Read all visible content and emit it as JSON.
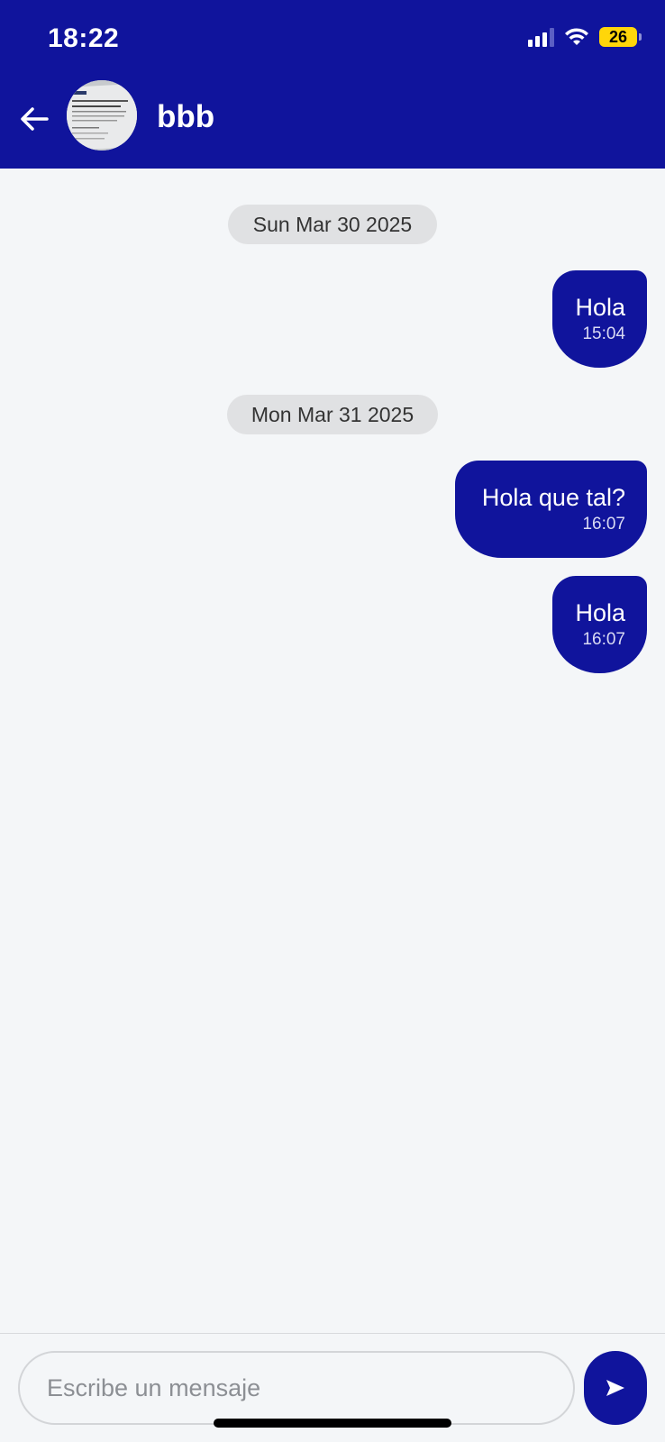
{
  "status_bar": {
    "time": "18:22",
    "battery": "26"
  },
  "header": {
    "contact_name": "bbb",
    "back_icon": "arrow-left-icon"
  },
  "colors": {
    "primary": "#10149c",
    "background": "#f4f6f8",
    "date_pill": "#e0e1e3"
  },
  "messages": [
    {
      "type": "date",
      "label": "Sun Mar 30 2025"
    },
    {
      "type": "outgoing",
      "text": "Hola",
      "time": "15:04"
    },
    {
      "type": "date",
      "label": "Mon Mar 31 2025"
    },
    {
      "type": "outgoing",
      "text": "Hola que tal?",
      "time": "16:07"
    },
    {
      "type": "outgoing",
      "text": "Hola",
      "time": "16:07"
    }
  ],
  "composer": {
    "placeholder": "Escribe un mensaje",
    "send_icon": "send-icon"
  }
}
